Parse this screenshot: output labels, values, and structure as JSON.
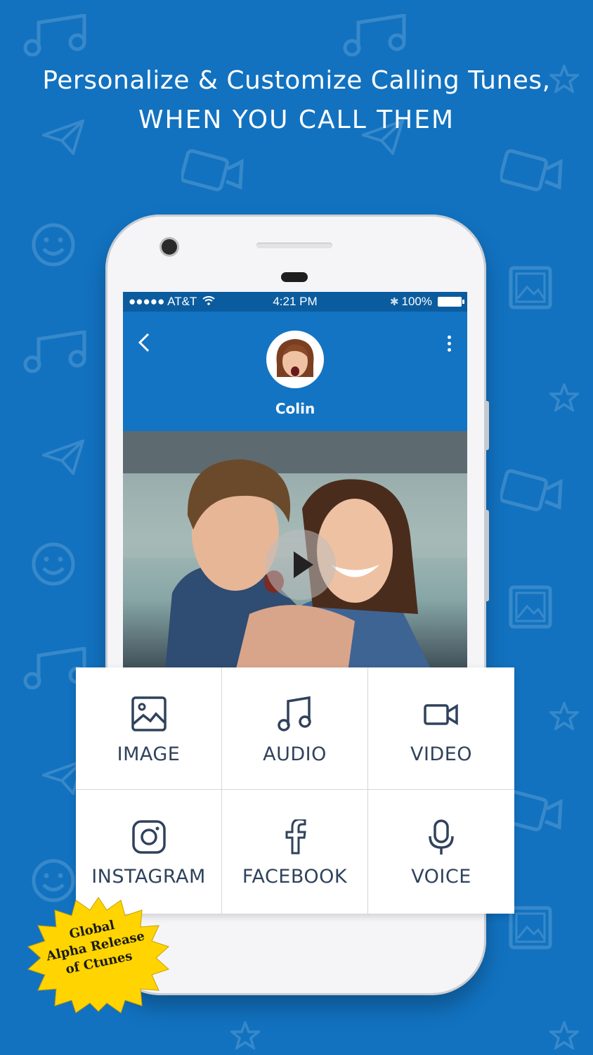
{
  "headline": {
    "line1": "Personalize & Customize Calling Tunes,",
    "line2": "WHEN YOU CALL THEM"
  },
  "status_bar": {
    "carrier": "●●●●● AT&T",
    "time": "4:21 PM",
    "battery": "100%"
  },
  "contact": {
    "name": "Colin"
  },
  "options": [
    {
      "label": "IMAGE",
      "icon": "image-icon"
    },
    {
      "label": "AUDIO",
      "icon": "music-note-icon"
    },
    {
      "label": "VIDEO",
      "icon": "video-camera-icon"
    },
    {
      "label": "INSTAGRAM",
      "icon": "instagram-icon"
    },
    {
      "label": "FACEBOOK",
      "icon": "facebook-icon"
    },
    {
      "label": "VOICE",
      "icon": "microphone-icon"
    }
  ],
  "badge": {
    "line1": "Global",
    "line2": "Alpha Release",
    "line3": "of Ctunes"
  },
  "colors": {
    "background": "#1272c0",
    "appbar": "#1374c3",
    "statusbar": "#0b5c9f",
    "badge": "#ffd400",
    "option_text": "#30425c"
  }
}
